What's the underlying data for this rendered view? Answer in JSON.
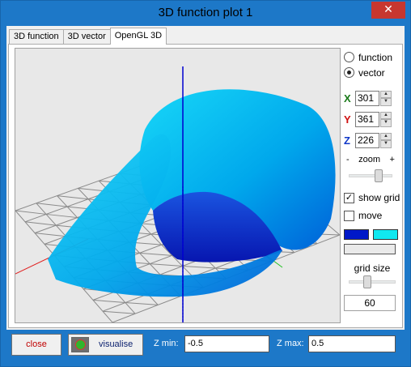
{
  "window": {
    "title": "3D function plot 1",
    "close_glyph": "✕"
  },
  "tabs": [
    {
      "label": "3D function"
    },
    {
      "label": "3D vector"
    },
    {
      "label": "OpenGL 3D",
      "active": true
    }
  ],
  "mode": {
    "options": [
      "function",
      "vector"
    ],
    "selected": "vector"
  },
  "coords": {
    "x": {
      "letter": "X",
      "value": "301",
      "color": "#1a7a1a"
    },
    "y": {
      "letter": "Y",
      "value": "361",
      "color": "#d01010"
    },
    "z": {
      "letter": "Z",
      "value": "226",
      "color": "#1038c8"
    }
  },
  "zoom": {
    "label": "zoom",
    "minus": "-",
    "plus": "+",
    "level": 0.72
  },
  "show_grid": {
    "label": "show grid",
    "checked": true
  },
  "move": {
    "label": "move",
    "checked": false
  },
  "colors": {
    "primary": "#0018c8",
    "secondary": "#10e8f0"
  },
  "grid_size": {
    "label": "grid size",
    "value": "60",
    "level": 0.4
  },
  "bottom": {
    "close_label": "close",
    "visualise_label": "visualise",
    "zmin_label": "Z min:",
    "zmin_value": "-0.5",
    "zmax_label": "Z max:",
    "zmax_value": "0.5"
  },
  "plot": {
    "surface_color": "#00c8f0",
    "shade_color": "#0a2fd0",
    "grid_color": "#8a8a8a",
    "axis_colors": {
      "x": "#20c020",
      "y": "#e02020",
      "z": "#0000d0"
    }
  }
}
